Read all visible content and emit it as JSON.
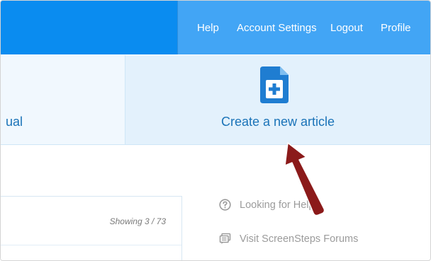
{
  "header": {
    "nav": [
      {
        "label": "Help",
        "name": "nav-help"
      },
      {
        "label": "Account Settings",
        "name": "nav-account-settings"
      },
      {
        "label": "Logout",
        "name": "nav-logout"
      },
      {
        "label": "Profile",
        "name": "nav-profile"
      }
    ]
  },
  "cards": {
    "partial_label": "ual",
    "create_label": "Create a new article",
    "create_icon": "document-add-icon"
  },
  "list_panel": {
    "showing_text": "Showing 3 / 73"
  },
  "help_links": [
    {
      "label": "Looking for Help?",
      "icon": "question-circle-icon"
    },
    {
      "label": "Visit ScreenSteps Forums",
      "icon": "forum-icon"
    }
  ],
  "annotation": {
    "arrow_color": "#8b1a1a"
  },
  "colors": {
    "header_blue": "#42a5f5",
    "header_dark_blue": "#0a8cf0",
    "link_blue": "#1a73b8",
    "icon_blue": "#1f7dd1"
  }
}
